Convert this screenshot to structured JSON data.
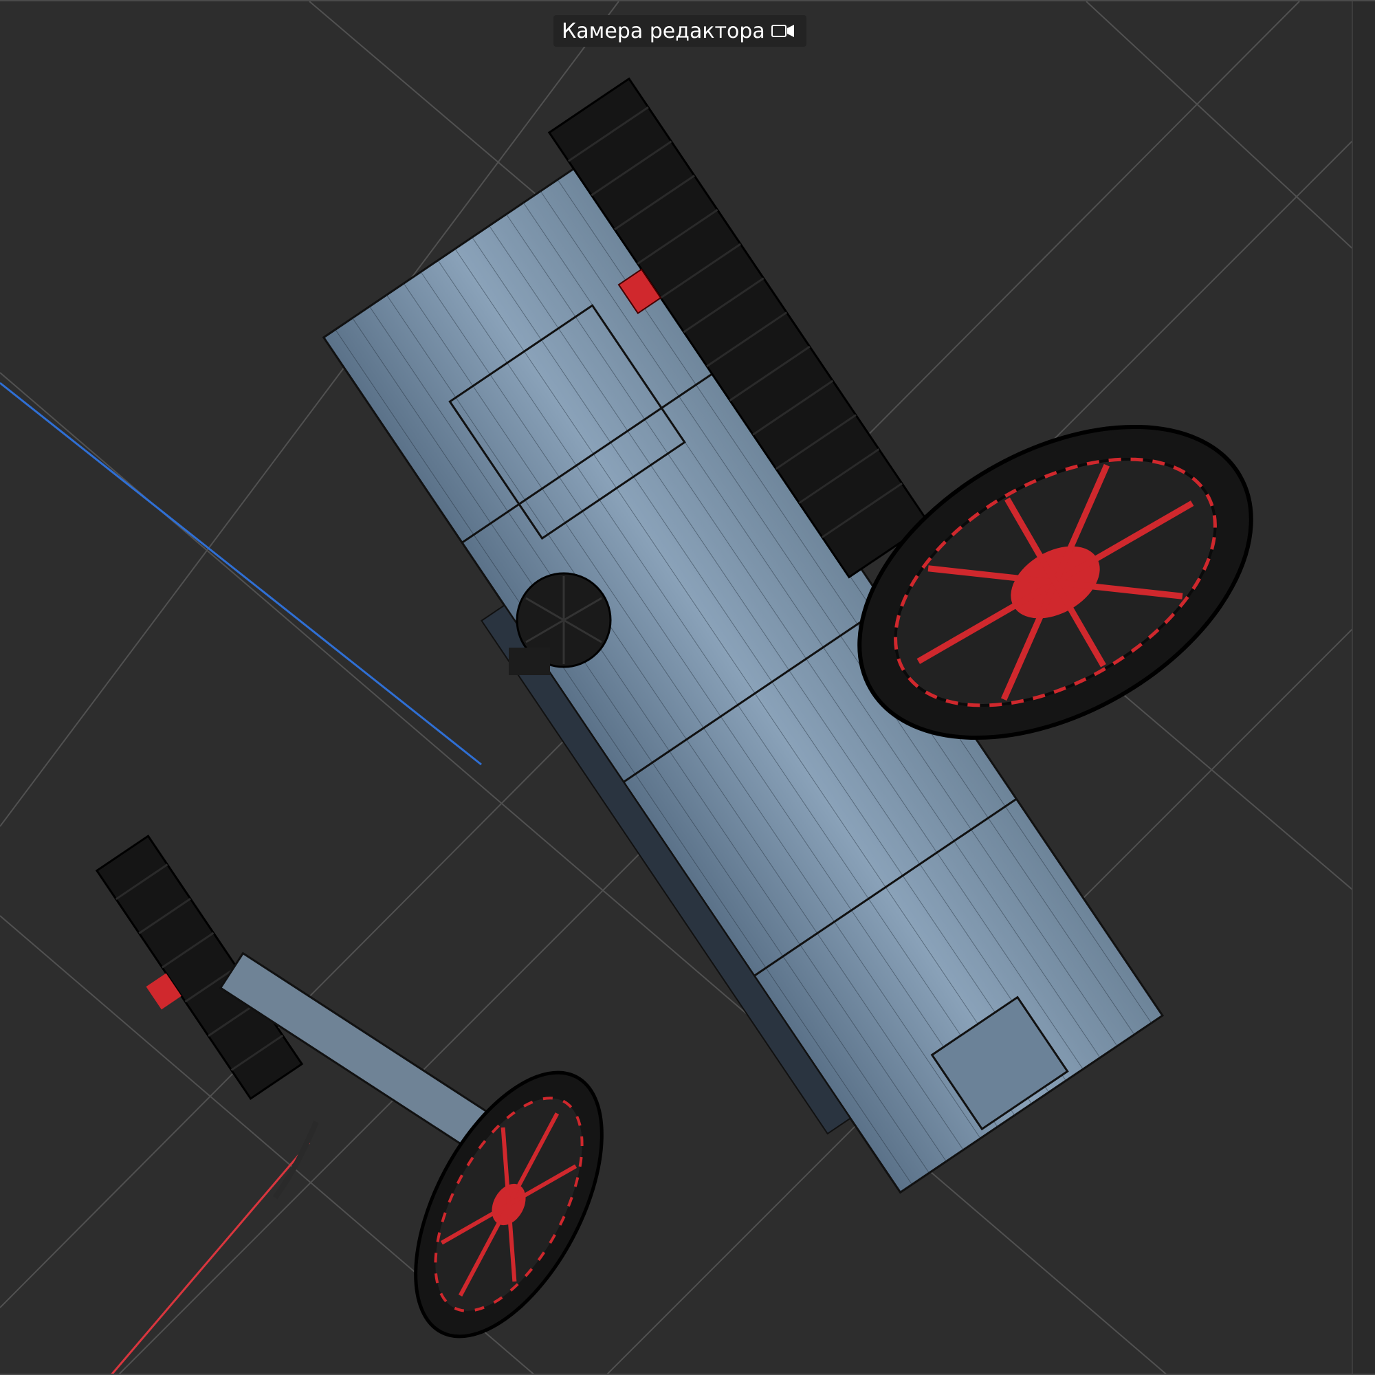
{
  "viewport": {
    "camera_label": "Камера редактора",
    "camera_icon": "video-camera-icon"
  },
  "colors": {
    "background": "#2d2d2d",
    "grid": "#555555",
    "axis_x": "#d9363e",
    "axis_y": "#3aa655",
    "axis_z": "#2f6fd4",
    "body": "#8fa6bd",
    "tire": "#151515",
    "rim": "#d0282d"
  }
}
